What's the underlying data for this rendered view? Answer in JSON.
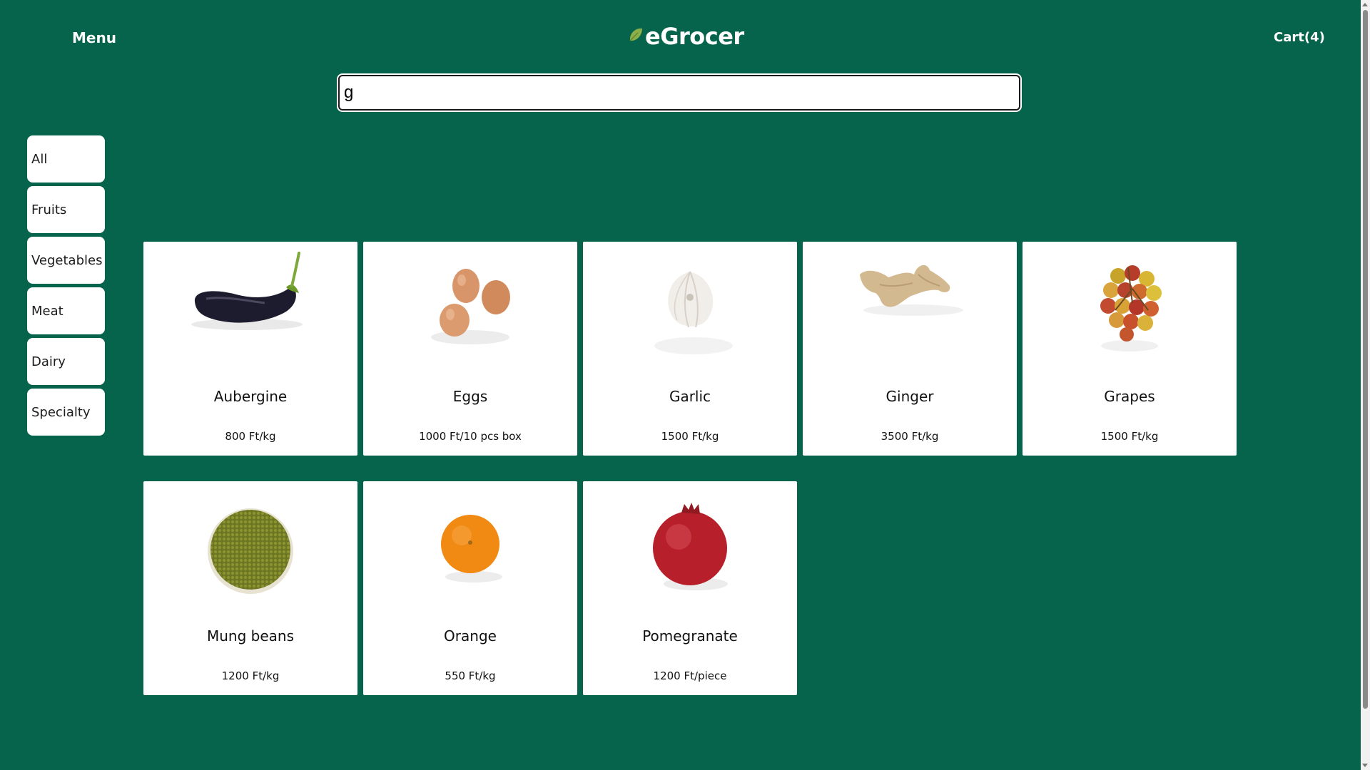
{
  "header": {
    "menu_label": "Menu",
    "logo_text": "eGrocer",
    "cart_label": "Cart(4)"
  },
  "search": {
    "value": "g",
    "placeholder": ""
  },
  "categories": [
    {
      "label": "All"
    },
    {
      "label": "Fruits"
    },
    {
      "label": "Vegetables"
    },
    {
      "label": "Meat"
    },
    {
      "label": "Dairy"
    },
    {
      "label": "Specialty"
    }
  ],
  "products": [
    {
      "name": "Aubergine",
      "price": "800 Ft/kg",
      "icon": "aubergine-image"
    },
    {
      "name": "Eggs",
      "price": "1000 Ft/10 pcs box",
      "icon": "eggs-image"
    },
    {
      "name": "Garlic",
      "price": "1500 Ft/kg",
      "icon": "garlic-image"
    },
    {
      "name": "Ginger",
      "price": "3500 Ft/kg",
      "icon": "ginger-image"
    },
    {
      "name": "Grapes",
      "price": "1500 Ft/kg",
      "icon": "grapes-image"
    },
    {
      "name": "Mung beans",
      "price": "1200 Ft/kg",
      "icon": "mung-beans-image"
    },
    {
      "name": "Orange",
      "price": "550 Ft/kg",
      "icon": "orange-image"
    },
    {
      "name": "Pomegranate",
      "price": "1200 Ft/piece",
      "icon": "pomegranate-image"
    }
  ],
  "colors": {
    "background": "#07644c",
    "card": "#ffffff",
    "leaf": "#8bb04a"
  }
}
